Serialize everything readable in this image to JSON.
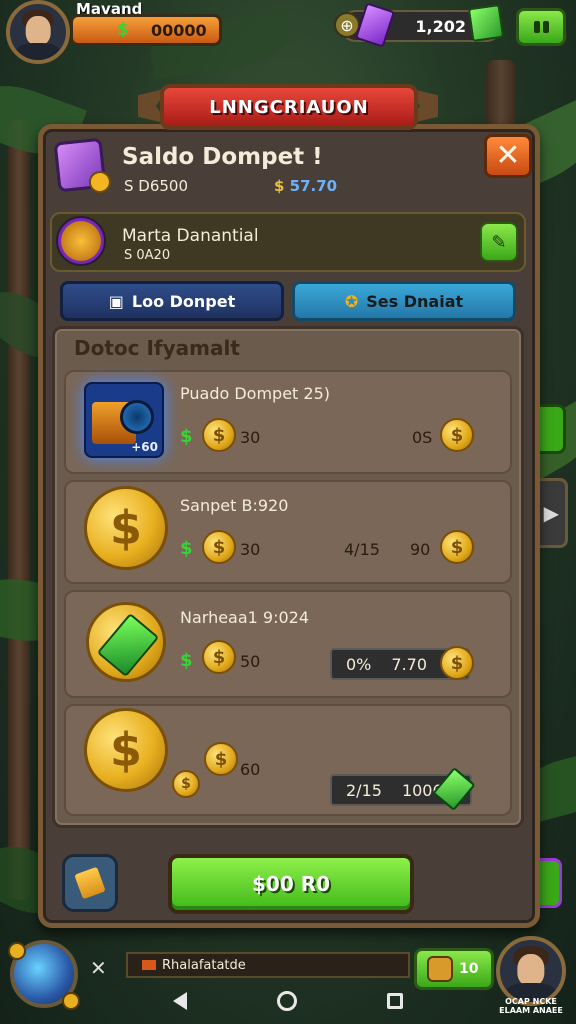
{
  "hud": {
    "player_name": "Mavand",
    "money_symbol": "$",
    "money_value": "00000",
    "gems_value": "1,202"
  },
  "banner": {
    "title": "LNNGCRIAUON"
  },
  "wallet": {
    "title": "Saldo Dompet !",
    "sub_left": "S D6500",
    "sub_right_symbol": "$",
    "sub_right_value": "57.70"
  },
  "sub_wallet": {
    "title": "Marta Danantial",
    "value": "S 0A20"
  },
  "tabs": [
    {
      "label": "Loo Donpet",
      "icon": "wallet-icon"
    },
    {
      "label": "Ses Dnaiat",
      "icon": "coin-stack-icon"
    }
  ],
  "list": {
    "header": "Dotoc Ifyamalt",
    "items": [
      {
        "title": "Puado Dompet 25)",
        "symbol": "$",
        "amount": "30",
        "right_label": "0S",
        "badge": "+60"
      },
      {
        "title": "Sanpet B:920",
        "symbol": "$",
        "amount": "30",
        "mid_label": "4/15",
        "right_label": "90"
      },
      {
        "title": "Narheaa1 9:024",
        "symbol": "$",
        "amount": "50",
        "pill_left": "0%",
        "pill_right": "7.70"
      },
      {
        "title": "",
        "amount": "60",
        "pill_left": "2/15",
        "pill_right": "1006"
      }
    ]
  },
  "buy_button": {
    "label": "$00 R0"
  },
  "bottom": {
    "status_text": "Rhalafatatde",
    "green_value": "10",
    "profile_caption": "OCAP NCKE ELAAM ANAEE"
  },
  "colors": {
    "accent_green": "#40b81a",
    "banner_red": "#a81c18",
    "panel_brown": "#4a3f38",
    "tab_blue": "#1f3260",
    "tab_cyan": "#2478a8"
  }
}
